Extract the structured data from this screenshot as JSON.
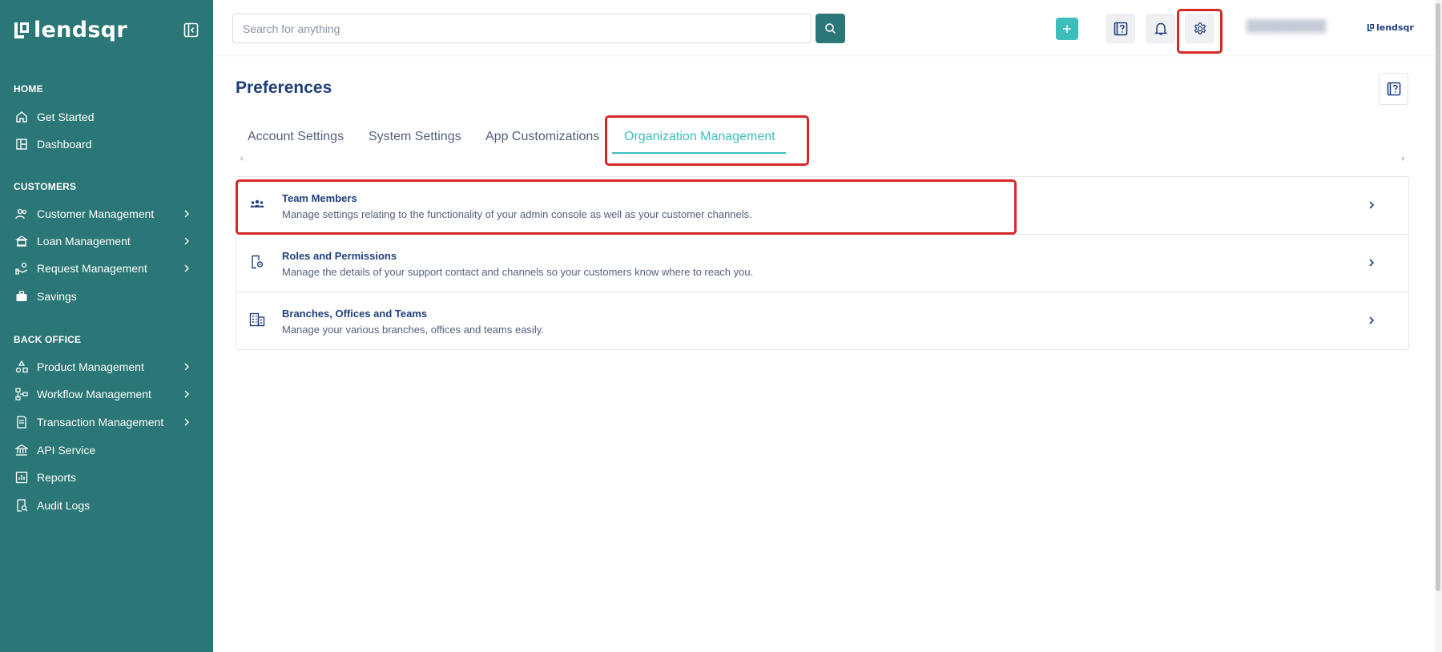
{
  "brand": {
    "name": "lendsqr"
  },
  "sidebar": {
    "sections": [
      {
        "title": "HOME"
      },
      {
        "title": "CUSTOMERS"
      },
      {
        "title": "BACK OFFICE"
      }
    ],
    "items": [
      {
        "label": "Get Started",
        "icon": "home-icon"
      },
      {
        "label": "Dashboard",
        "icon": "dashboard-icon"
      },
      {
        "label": "Customer Management",
        "icon": "users-icon"
      },
      {
        "label": "Loan Management",
        "icon": "loan-icon"
      },
      {
        "label": "Request Management",
        "icon": "request-icon"
      },
      {
        "label": "Savings",
        "icon": "briefcase-icon"
      },
      {
        "label": "Product Management",
        "icon": "shapes-icon"
      },
      {
        "label": "Workflow Management",
        "icon": "workflow-icon"
      },
      {
        "label": "Transaction Management",
        "icon": "transaction-icon"
      },
      {
        "label": "API Service",
        "icon": "bank-icon"
      },
      {
        "label": "Reports",
        "icon": "chart-icon"
      },
      {
        "label": "Audit Logs",
        "icon": "audit-icon"
      }
    ]
  },
  "topbar": {
    "search_placeholder": "Search for anything",
    "search_value": "",
    "org_logo_text": "lendsqr"
  },
  "page": {
    "title": "Preferences",
    "tabs": [
      {
        "label": "Account Settings"
      },
      {
        "label": "System Settings"
      },
      {
        "label": "App Customizations"
      },
      {
        "label": "Organization Management"
      }
    ],
    "active_tab": "Organization Management",
    "rows": [
      {
        "title": "Team Members",
        "description": "Manage settings relating to the functionality of your admin console as well as your customer channels."
      },
      {
        "title": "Roles and Permissions",
        "description": "Manage the details of your support contact and channels so your customers know where to reach you."
      },
      {
        "title": "Branches, Offices and Teams",
        "description": "Manage your various branches, offices and teams easily."
      }
    ]
  },
  "colors": {
    "sidebar_bg": "#2b7676",
    "accent": "#3ebdbd",
    "primary_text": "#213f7d",
    "secondary_text": "#545f7d",
    "highlight": "#d62828"
  }
}
